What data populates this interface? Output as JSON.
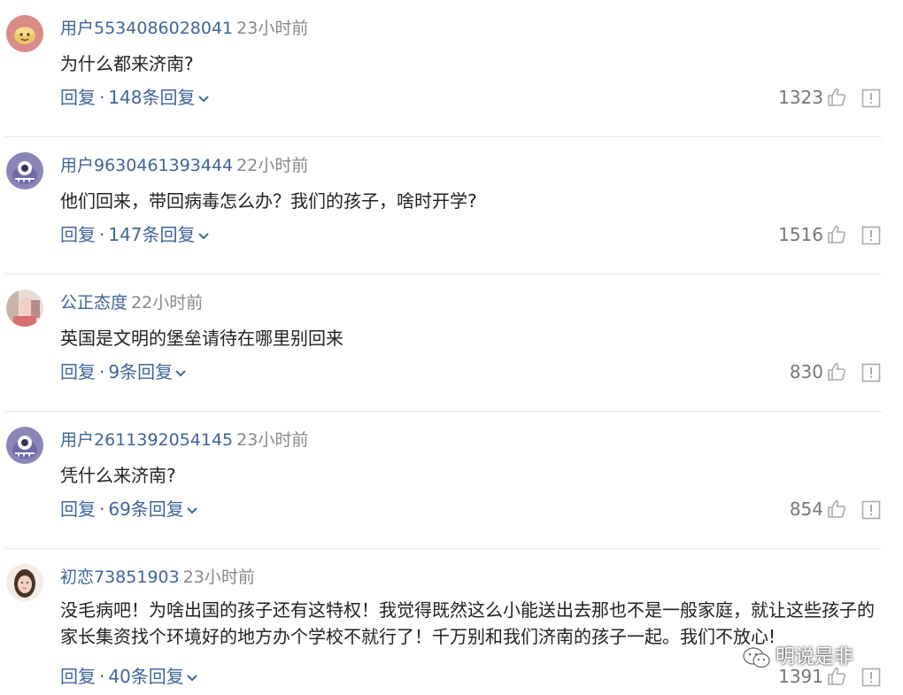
{
  "comments": [
    {
      "username": "用户5534086028041",
      "time": "23小时前",
      "content": "为什么都来济南?",
      "reply_label": "回复",
      "reply_count": "148条回复",
      "likes": "1323",
      "avatar_icon": "cookie-avatar"
    },
    {
      "username": "用户9630461393444",
      "time": "22小时前",
      "content": "他们回来，带回病毒怎么办？我们的孩子，啥时开学?",
      "reply_label": "回复",
      "reply_count": "147条回复",
      "likes": "1516",
      "avatar_icon": "monster-avatar"
    },
    {
      "username": "公正态度",
      "time": "22小时前",
      "content": "英国是文明的堡垒请待在哪里别回来",
      "reply_label": "回复",
      "reply_count": "9条回复",
      "likes": "830",
      "avatar_icon": "photo-avatar"
    },
    {
      "username": "用户2611392054145",
      "time": "23小时前",
      "content": "凭什么来济南?",
      "reply_label": "回复",
      "reply_count": "69条回复",
      "likes": "854",
      "avatar_icon": "monster-avatar"
    },
    {
      "username": "初恋73851903",
      "time": "23小时前",
      "content": "没毛病吧！为啥出国的孩子还有这特权！我觉得既然这么小能送出去那也不是一般家庭，就让这些孩子的家长集资找个环境好的地方办个学校不就行了！千万别和我们济南的孩子一起。我们不放心!",
      "reply_label": "回复",
      "reply_count": "40条回复",
      "likes": "1391",
      "avatar_icon": "girl-photo-avatar"
    }
  ],
  "separator": "·",
  "watermark": "明说是非",
  "colors": {
    "link": "#406599",
    "meta": "#888888",
    "divider": "#e6e6e6"
  }
}
